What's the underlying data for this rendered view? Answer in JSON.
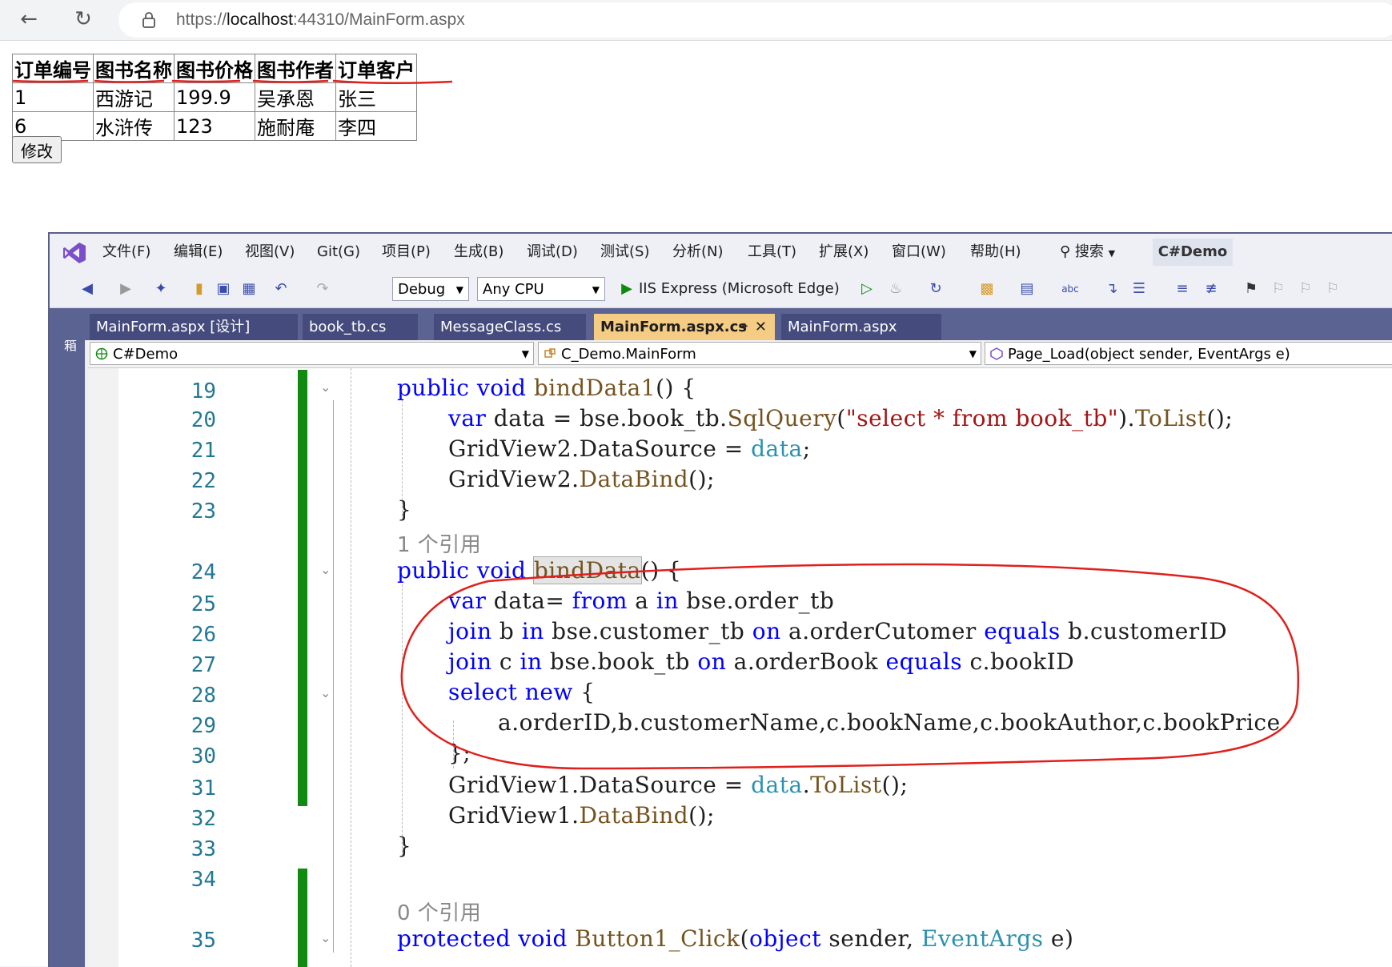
{
  "browser": {
    "url_prefix": "https://",
    "url_host": "localhost",
    "url_rest": ":44310/MainForm.aspx"
  },
  "web_grid": {
    "headers": [
      "订单编号",
      "图书名称",
      "图书价格",
      "图书作者",
      "订单客户"
    ],
    "rows": [
      [
        "1",
        "西游记",
        "199.9",
        "吴承恩",
        "张三"
      ],
      [
        "6",
        "水浒传",
        "123",
        "施耐庵",
        "李四"
      ]
    ],
    "button_label": "修改"
  },
  "vs": {
    "menu": [
      "文件(F)",
      "编辑(E)",
      "视图(V)",
      "Git(G)",
      "项目(P)",
      "生成(B)",
      "调试(D)",
      "测试(S)",
      "分析(N)",
      "工具(T)",
      "扩展(X)",
      "窗口(W)",
      "帮助(H)"
    ],
    "search_label": "搜索",
    "project_badge": "C#Demo",
    "config_combo": "Debug",
    "platform_combo": "Any CPU",
    "run_label": "IIS Express (Microsoft Edge)",
    "toolbox_label": "工具箱",
    "tabs": [
      "MainForm.aspx [设计]",
      "book_tb.cs",
      "MessageClass.cs",
      "MainForm.aspx.cs",
      "MainForm.aspx"
    ],
    "active_tab_index": 3,
    "nav_project": "C#Demo",
    "nav_class": "C_Demo.MainForm",
    "nav_member": "Page_Load(object sender, EventArgs e)"
  },
  "code": {
    "line_numbers": [
      "19",
      "20",
      "21",
      "22",
      "23",
      "24",
      "25",
      "26",
      "27",
      "28",
      "29",
      "30",
      "31",
      "32",
      "33",
      "34",
      "35"
    ],
    "ref_1": "1 个引用",
    "ref_0": "0 个引用",
    "l19": {
      "a": "public void ",
      "b": "bindData1",
      "c": "() {"
    },
    "l20": {
      "a": "var",
      "b": " data = bse.book_tb.",
      "c": "SqlQuery",
      "d": "(",
      "e": "\"select * from book_tb\"",
      "f": ").",
      "g": "ToList",
      "h": "();"
    },
    "l21": {
      "a": "GridView2.DataSource = ",
      "b": "data",
      "c": ";"
    },
    "l22": {
      "a": "GridView2.",
      "b": "DataBind",
      "c": "();"
    },
    "l23": "}",
    "l24": {
      "a": "public void ",
      "b": "bindData",
      "c": "() {"
    },
    "l25": {
      "a": "var",
      "b": " data= ",
      "c": "from",
      "d": " a ",
      "e": "in",
      "f": " bse.order_tb"
    },
    "l26": {
      "a": "join",
      "b": " b ",
      "c": "in",
      "d": " bse.customer_tb ",
      "e": "on",
      "f": " a.orderCutomer ",
      "g": "equals",
      "h": " b.customerID"
    },
    "l27": {
      "a": "join",
      "b": " c ",
      "c": "in",
      "d": " bse.book_tb ",
      "e": "on",
      "f": " a.orderBook ",
      "g": "equals",
      "h": " c.bookID"
    },
    "l28": {
      "a": "select new",
      "b": " {"
    },
    "l29": "a.orderID,b.customerName,c.bookName,c.bookAuthor,c.bookPrice",
    "l30": "};",
    "l31": {
      "a": "GridView1.DataSource = ",
      "b": "data",
      "c": ".",
      "d": "ToList",
      "e": "();"
    },
    "l32": {
      "a": "GridView1.",
      "b": "DataBind",
      "c": "();"
    },
    "l33": "}",
    "l35": {
      "a": "protected void ",
      "b": "Button1_Click",
      "c": "(",
      "d": "object",
      "e": " sender, ",
      "f": "EventArgs",
      "g": " e)"
    }
  },
  "colors": {
    "keyword": "#0000ff",
    "type": "#2b91af",
    "method": "#74531f",
    "string": "#a31515",
    "annotation": "#e0201c",
    "change_bar": "#108a10"
  }
}
